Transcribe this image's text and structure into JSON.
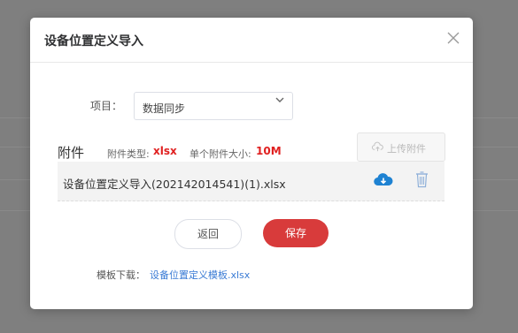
{
  "dialog": {
    "title": "设备位置定义导入",
    "close_icon": "close-icon"
  },
  "project": {
    "label": "项目：",
    "selected": "数据同步",
    "arrow_icon": "chevron-down-icon"
  },
  "attachments": {
    "title": "附件",
    "type_label": "附件类型:",
    "type_value": "xlsx",
    "size_label": "单个附件大小:",
    "size_value": "10M",
    "upload_label": "上传附件",
    "upload_icon": "cloud-upload-icon",
    "files": [
      {
        "name": "设备位置定义导入(202142014541)(1).xlsx",
        "download_icon": "cloud-download-icon",
        "delete_icon": "trash-icon"
      }
    ]
  },
  "actions": {
    "back_label": "返回",
    "save_label": "保存"
  },
  "template": {
    "label": "模板下载：",
    "link_text": "设备位置定义模板.xlsx"
  },
  "colors": {
    "overlay": "#7f7f7f",
    "accent_red": "#e02020",
    "save_button": "#d83b3b",
    "download_icon": "#1e82d2",
    "delete_icon": "#8fb0d9",
    "link": "#3a7bd5"
  }
}
